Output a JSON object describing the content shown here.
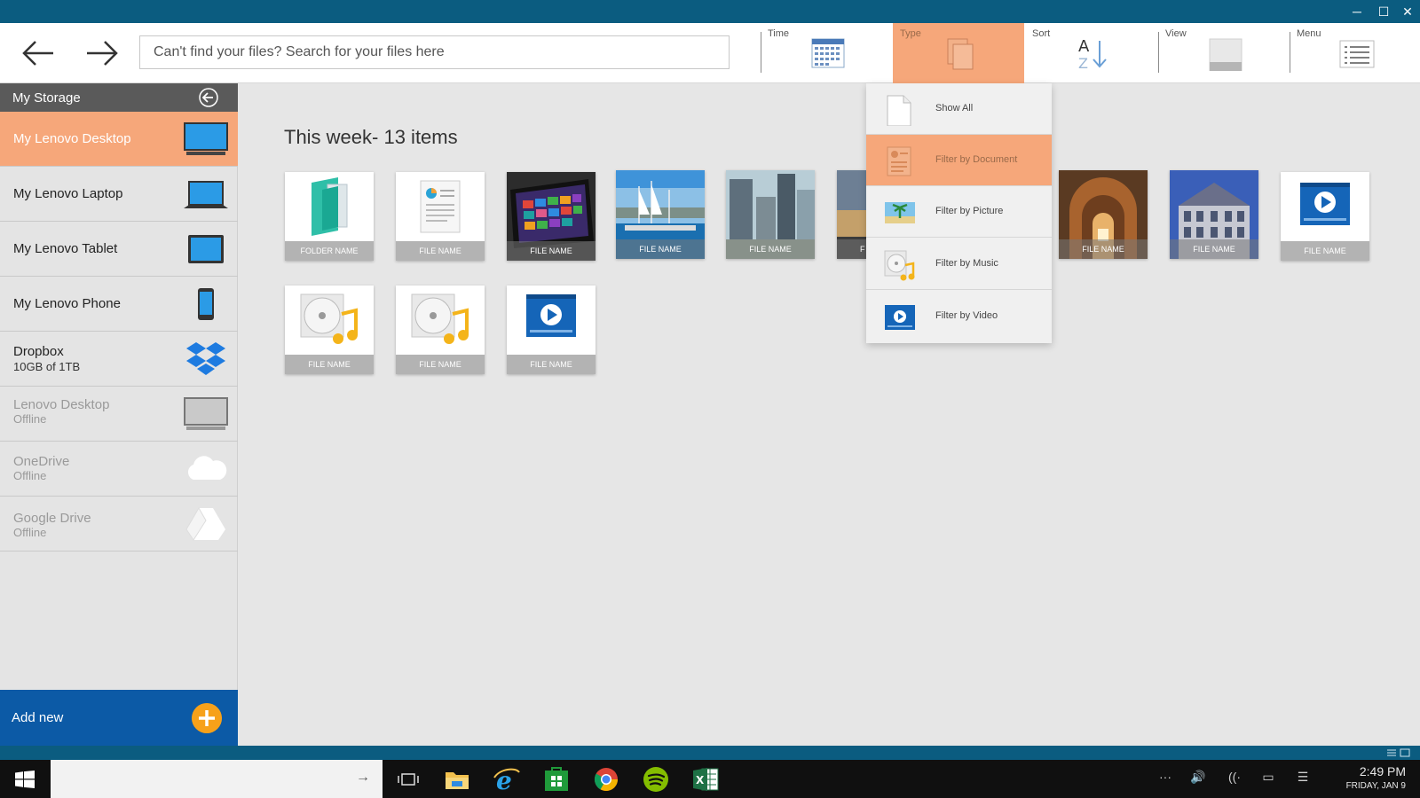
{
  "window": {
    "controls": {
      "minimize": "─",
      "maximize": "☐",
      "close": "✕"
    }
  },
  "toolbar": {
    "back_icon": "back-arrow-icon",
    "forward_icon": "forward-arrow-icon",
    "search_placeholder": "Can't find your files? Search for your files here",
    "tools": [
      {
        "label": "Time",
        "icon": "calendar-icon",
        "active": false
      },
      {
        "label": "Type",
        "icon": "documents-icon",
        "active": true
      },
      {
        "label": "Sort",
        "icon": "sort-az-icon",
        "active": false
      },
      {
        "label": "View",
        "icon": "view-tile-icon",
        "active": false
      },
      {
        "label": "Menu",
        "icon": "list-menu-icon",
        "active": false
      }
    ]
  },
  "sidebar": {
    "title": "My Storage",
    "items": [
      {
        "name": "My Lenovo Desktop",
        "sub": "",
        "icon": "desktop-icon",
        "state": "selected"
      },
      {
        "name": "My Lenovo Laptop",
        "sub": "",
        "icon": "laptop-icon",
        "state": "normal"
      },
      {
        "name": "My Lenovo Tablet",
        "sub": "",
        "icon": "tablet-icon",
        "state": "normal"
      },
      {
        "name": "My Lenovo Phone",
        "sub": "",
        "icon": "phone-icon",
        "state": "normal"
      },
      {
        "name": "Dropbox",
        "sub": "10GB of 1TB",
        "icon": "dropbox-icon",
        "state": "normal"
      },
      {
        "name": "Lenovo Desktop",
        "sub": "Offline",
        "icon": "desktop-offline-icon",
        "state": "offline"
      },
      {
        "name": "OneDrive",
        "sub": "Offline",
        "icon": "cloud-icon",
        "state": "offline"
      },
      {
        "name": "Google Drive",
        "sub": "Offline",
        "icon": "google-drive-icon",
        "state": "offline"
      }
    ],
    "add_new_label": "Add new"
  },
  "main": {
    "heading": "This week- 13 items",
    "tiles": [
      {
        "caption": "FOLDER NAME",
        "kind": "folder"
      },
      {
        "caption": "FILE NAME",
        "kind": "document"
      },
      {
        "caption": "FILE NAME",
        "kind": "tablet"
      },
      {
        "caption": "FILE NAME",
        "kind": "harbor"
      },
      {
        "caption": "FILE NAME",
        "kind": "city"
      },
      {
        "caption": "F",
        "kind": "sunset"
      },
      {
        "caption": "FILE NAME",
        "kind": "arch"
      },
      {
        "caption": "FILE NAME",
        "kind": "building"
      },
      {
        "caption": "FILE NAME",
        "kind": "video"
      },
      {
        "caption": "FILE NAME",
        "kind": "music"
      },
      {
        "caption": "FILE NAME",
        "kind": "music"
      },
      {
        "caption": "FILE NAME",
        "kind": "video"
      }
    ]
  },
  "type_menu": {
    "items": [
      {
        "label": "Show All",
        "icon": "blank-page-icon",
        "active": false
      },
      {
        "label": "Filter by Document",
        "icon": "document-icon",
        "active": true
      },
      {
        "label": "Filter by Picture",
        "icon": "picture-icon",
        "active": false
      },
      {
        "label": "Filter by Music",
        "icon": "music-icon",
        "active": false
      },
      {
        "label": "Filter by Video",
        "icon": "video-icon",
        "active": false
      }
    ]
  },
  "taskbar": {
    "search_arrow": "→",
    "apps": [
      {
        "name": "task-view-icon"
      },
      {
        "name": "file-explorer-icon"
      },
      {
        "name": "internet-explorer-icon"
      },
      {
        "name": "store-icon"
      },
      {
        "name": "chrome-icon"
      },
      {
        "name": "spotify-icon"
      },
      {
        "name": "excel-icon"
      }
    ],
    "tray": {
      "more": "···",
      "volume": "🔊",
      "wifi": "((·",
      "battery": "▭",
      "action_center": "☰"
    },
    "clock": {
      "time": "2:49 PM",
      "date": "FRIDAY, JAN 9"
    }
  },
  "colors": {
    "accent_orange": "#f6a77a",
    "title_bar": "#0b5c80",
    "add_new_blue": "#0c5aa6",
    "plus_orange": "#f7a11a"
  }
}
